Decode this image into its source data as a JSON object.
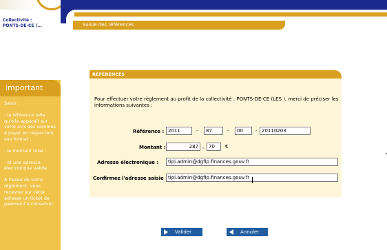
{
  "sidebar": {
    "collectivite_label": "Collectivité :",
    "collectivite_value": "PONTS-DE-CE (...",
    "important_title": "important",
    "important_paragraphs": [
      "Saisir :",
      "- la référence telle qu'elle apparaît sur votre avis des sommes à payer en respectant son format ;",
      "- le montant total ;",
      "- et une adresse électronique valide.",
      "A l'issue de votre règlement, vous recevrez sur cette adresse un ticket de paiement à conserver."
    ]
  },
  "header": {
    "breadcrumb": "Saisie des références"
  },
  "form": {
    "section_title": "RÉFÉRENCES",
    "intro": "Pour effectuer votre règlement au profit de la collectivité : PONTS-DE-CE (LES ), merci de préciser les informations suivantes :",
    "reference_label": "Référence :",
    "reference_parts": [
      "2011",
      "87",
      "00",
      "20110203"
    ],
    "reference_separator": "-",
    "montant_label": "Montant :",
    "montant_euros": "287",
    "montant_separator": ",",
    "montant_cents": "70",
    "currency": "€",
    "email_label": "Adresse électronique :",
    "email_value": "tipi.admin@dgfip.finances.gouv.fr",
    "confirm_label": "Confirmez l'adresse saisie :",
    "confirm_value": "tipi.admin@dgfip.finances.gouv.fr"
  },
  "actions": {
    "validate_label": "Valider",
    "validate_icon": "arrow-right-icon",
    "cancel_label": "Annuler",
    "cancel_icon": "arrow-left-icon"
  },
  "colors": {
    "navy": "#1b2a8c",
    "gold": "#d99f1e",
    "light_gold": "#f0c44b",
    "panel_bg": "#fff5d8",
    "button_blue": "#1f5da0"
  }
}
